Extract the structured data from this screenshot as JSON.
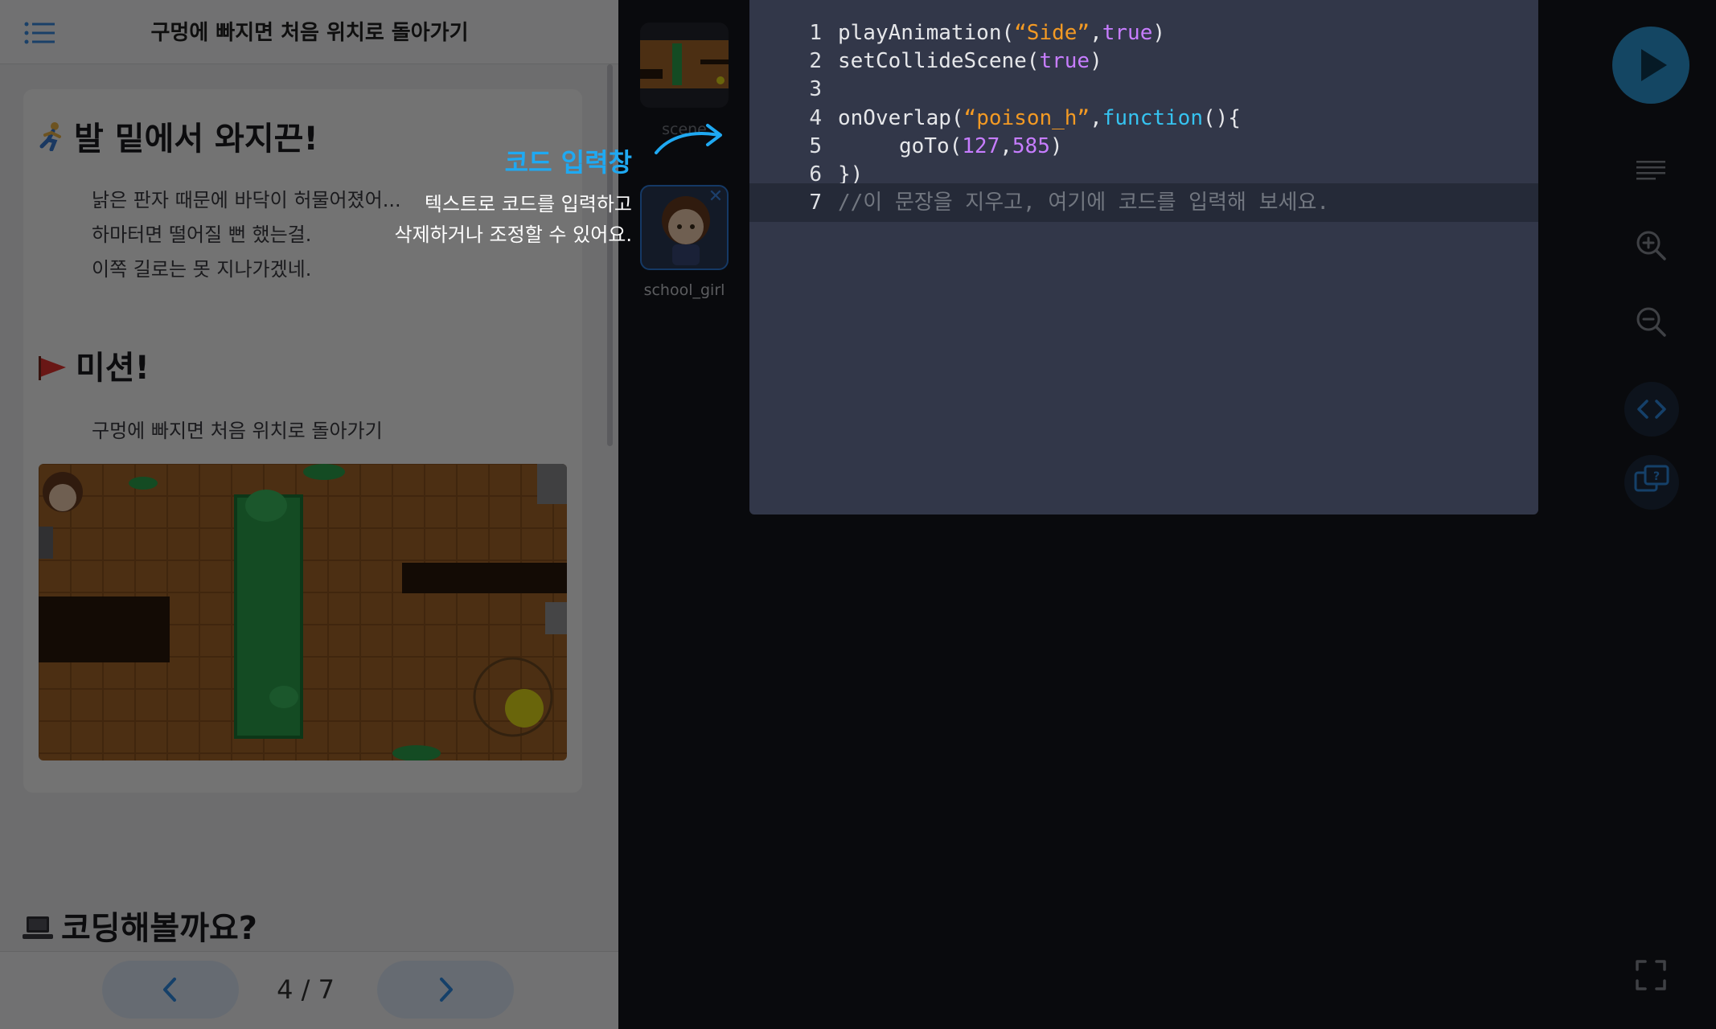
{
  "lesson": {
    "title": "구멍에 빠지면 처음 위치로 돌아가기",
    "story_heading": "발 밑에서 와지끈!",
    "story_lines": [
      "낡은 판자 때문에 바닥이 허물어졌어...",
      "하마터면 떨어질 뻔 했는걸.",
      "이쪽 길로는 못 지나가겠네."
    ],
    "mission_heading": "미션!",
    "mission_text": "구멍에 빠지면 처음 위치로 돌아가기",
    "coding_heading": "코딩해볼까요?",
    "page_indicator": "4 / 7"
  },
  "assets": {
    "scene_label": "scene",
    "sprite_label": "school_girl"
  },
  "code": {
    "lines": [
      {
        "num": "1",
        "tokens": [
          [
            "playAnimation(",
            ""
          ],
          [
            "“Side”",
            "s"
          ],
          [
            ",",
            ""
          ],
          [
            "true",
            "k"
          ],
          [
            ")",
            ""
          ]
        ]
      },
      {
        "num": "2",
        "tokens": [
          [
            "setCollideScene(",
            ""
          ],
          [
            "true",
            "k"
          ],
          [
            ")",
            ""
          ]
        ]
      },
      {
        "num": "3",
        "tokens": []
      },
      {
        "num": "4",
        "tokens": [
          [
            "onOverlap(",
            ""
          ],
          [
            "“poison_h”",
            "s"
          ],
          [
            ",",
            ""
          ],
          [
            "function",
            "f"
          ],
          [
            "(){",
            ""
          ]
        ]
      },
      {
        "num": "5",
        "tokens": [
          [
            "goTo(",
            ""
          ],
          [
            "127",
            "n"
          ],
          [
            ",",
            ""
          ],
          [
            "585",
            "n"
          ],
          [
            ")",
            ""
          ]
        ]
      },
      {
        "num": "6",
        "tokens": [
          [
            "})",
            ""
          ]
        ]
      },
      {
        "num": "7",
        "tokens": [
          [
            "//이 문장을 지우고, 여기에 코드를 입력해 보세요.",
            "c"
          ]
        ]
      }
    ]
  },
  "tutorial": {
    "title": "코드 입력창",
    "line1": "텍스트로 코드를 입력하고",
    "line2": "삭제하거나 조정할 수 있어요."
  },
  "icons": {
    "menu": "list-icon",
    "prev": "chevron-left-icon",
    "next": "chevron-right-icon",
    "run": "play-icon",
    "format": "align-lines-icon",
    "zoom_in": "zoom-in-icon",
    "zoom_out": "zoom-out-icon",
    "code_view": "code-brackets-icon",
    "help": "help-chat-icon",
    "fullscreen": "fullscreen-icon",
    "close": "close-icon"
  },
  "colors": {
    "accent": "#2d9cdb",
    "tutorial_title": "#1fa9f2",
    "string": "#f39a24",
    "keyword": "#c77dff",
    "function": "#36c3f0",
    "comment": "#727780"
  }
}
